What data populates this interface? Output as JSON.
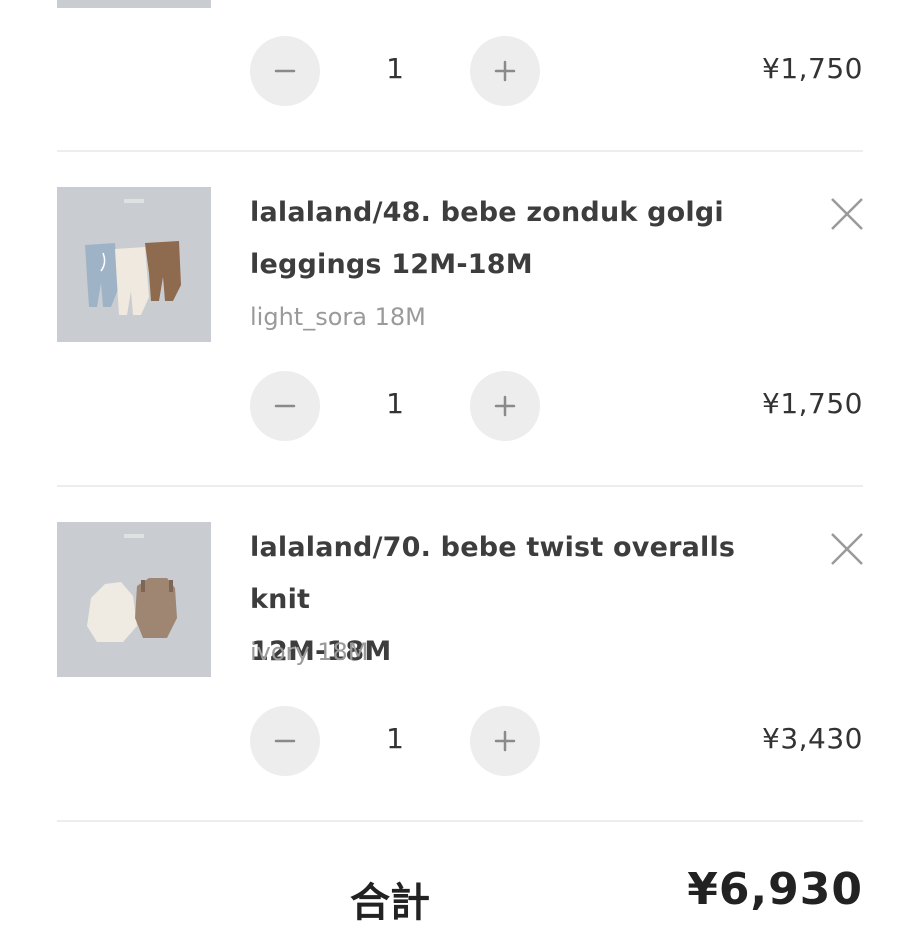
{
  "cart": {
    "items": [
      {
        "quantity": "1",
        "price": "¥1,750",
        "decrease_icon": "minus-icon",
        "increase_icon": "plus-icon"
      },
      {
        "title_line1": "lalaland/48. bebe zonduk golgi",
        "title_line2": "leggings 12M-18M",
        "variant": "light_sora 18M",
        "quantity": "1",
        "price": "¥1,750",
        "image_alt": "leggings product photo",
        "remove_icon": "close-icon",
        "decrease_icon": "minus-icon",
        "increase_icon": "plus-icon"
      },
      {
        "title_line1": "lalaland/70. bebe twist overalls knit",
        "title_line2": "12M-18M",
        "variant": "ivory 18M",
        "quantity": "1",
        "price": "¥3,430",
        "image_alt": "overalls knit product photo",
        "remove_icon": "close-icon",
        "decrease_icon": "minus-icon",
        "increase_icon": "plus-icon"
      }
    ]
  },
  "summary": {
    "total_label": "合計",
    "total_value": "¥6,930"
  },
  "colors": {
    "button_bg": "#ededed",
    "icon": "#8a8a8a",
    "divider": "#ededed"
  }
}
